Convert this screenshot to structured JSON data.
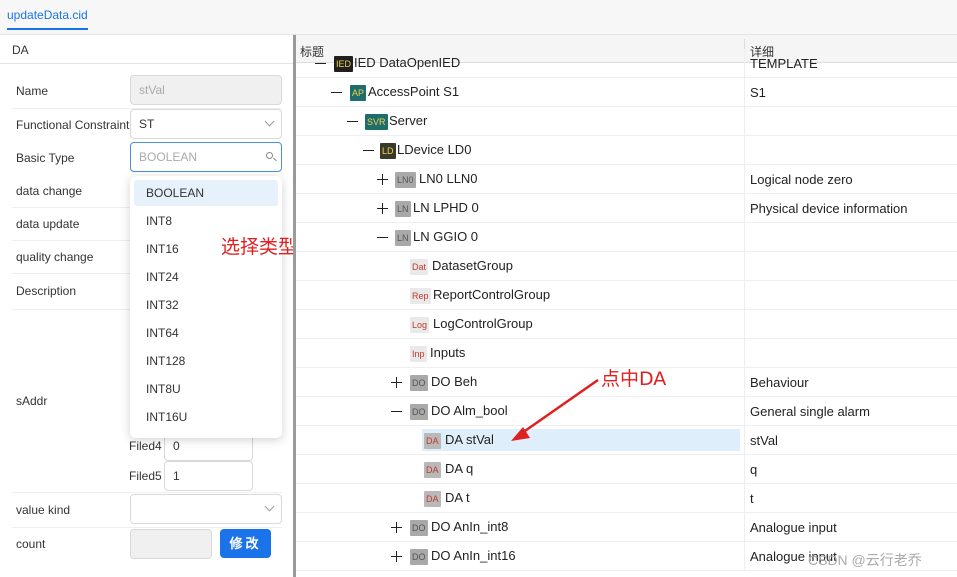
{
  "tab": {
    "label": "updateData.cid"
  },
  "left_panel": {
    "title": "DA",
    "fields": {
      "name": {
        "label": "Name",
        "value": "stVal"
      },
      "fc": {
        "label": "Functional Constraint",
        "value": "ST"
      },
      "basic_type": {
        "label": "Basic Type",
        "placeholder": "BOOLEAN"
      },
      "data_change": {
        "label": "data change"
      },
      "data_update": {
        "label": "data update"
      },
      "quality_change": {
        "label": "quality change"
      },
      "description": {
        "label": "Description"
      },
      "saddr": {
        "label": "sAddr"
      },
      "filed4": {
        "label": "Filed4",
        "value": "0"
      },
      "filed5": {
        "label": "Filed5",
        "value": "1"
      },
      "value_kind": {
        "label": "value kind",
        "value": ""
      },
      "count": {
        "label": "count",
        "value": ""
      }
    },
    "modify_button": "修改"
  },
  "dropdown": {
    "options": [
      "BOOLEAN",
      "INT8",
      "INT16",
      "INT24",
      "INT32",
      "INT64",
      "INT128",
      "INT8U",
      "INT16U"
    ],
    "selected": "BOOLEAN"
  },
  "annotations": {
    "select_type": "选择类型",
    "click_da": "点中DA"
  },
  "tree": {
    "header": {
      "title": "标题",
      "detail": "详细"
    },
    "rows": [
      {
        "badge": "IED",
        "label": "IED DataOpenIED",
        "detail": "TEMPLATE"
      },
      {
        "badge": "AP",
        "label": "AccessPoint S1",
        "detail": "S1"
      },
      {
        "badge": "SVR",
        "label": "Server",
        "detail": ""
      },
      {
        "badge": "LD",
        "label": "LDevice LD0",
        "detail": ""
      },
      {
        "badge": "LN0",
        "label": "LN0 LLN0",
        "detail": "Logical node zero"
      },
      {
        "badge": "LN",
        "label": "LN LPHD 0",
        "detail": "Physical device information"
      },
      {
        "badge": "LN",
        "label": "LN GGIO 0",
        "detail": ""
      },
      {
        "badge": "Dat",
        "label": "DatasetGroup",
        "detail": ""
      },
      {
        "badge": "Rep",
        "label": "ReportControlGroup",
        "detail": ""
      },
      {
        "badge": "Log",
        "label": "LogControlGroup",
        "detail": ""
      },
      {
        "badge": "Inp",
        "label": "Inputs",
        "detail": ""
      },
      {
        "badge": "DO",
        "label": "DO Beh",
        "detail": "Behaviour"
      },
      {
        "badge": "DO",
        "label": "DO Alm_bool",
        "detail": "General single alarm"
      },
      {
        "badge": "DA",
        "label": "DA stVal",
        "detail": "stVal"
      },
      {
        "badge": "DA",
        "label": "DA q",
        "detail": "q"
      },
      {
        "badge": "DA",
        "label": "DA t",
        "detail": "t"
      },
      {
        "badge": "DO",
        "label": "DO AnIn_int8",
        "detail": "Analogue input"
      },
      {
        "badge": "DO",
        "label": "DO AnIn_int16",
        "detail": "Analogue input"
      }
    ]
  },
  "watermark": "CSDN @云行老乔"
}
